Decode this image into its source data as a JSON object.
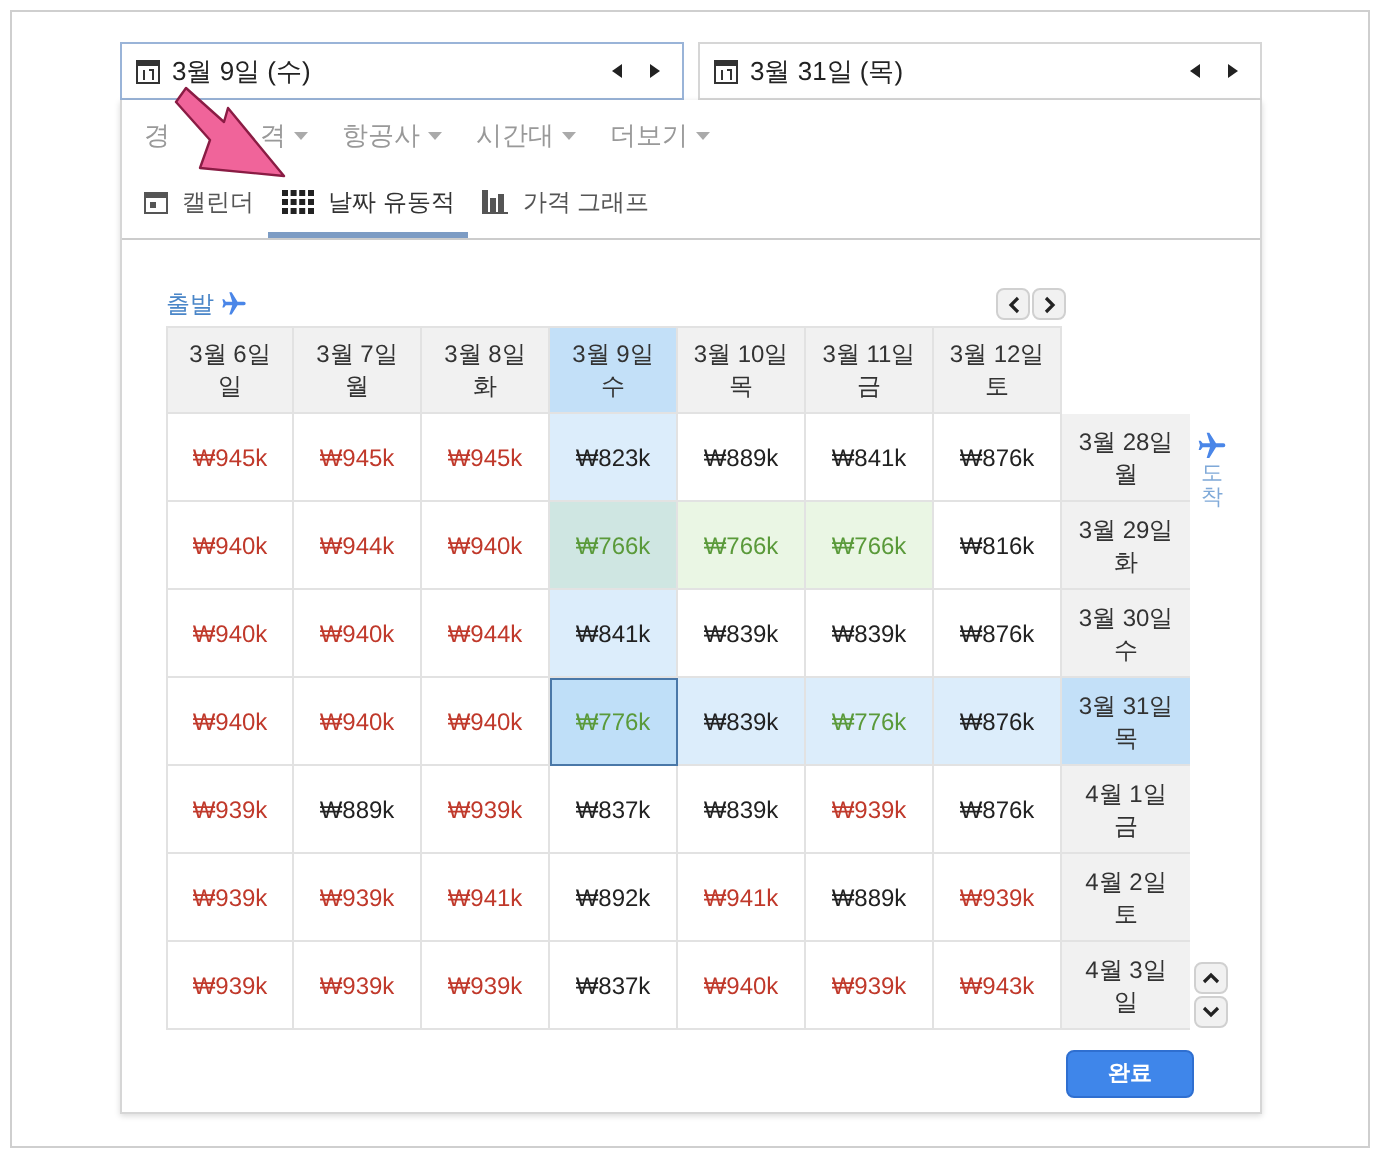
{
  "date_fields": [
    {
      "value": "3월 9일 (수)",
      "selected": true
    },
    {
      "value": "3월 31일 (목)",
      "selected": false
    }
  ],
  "filters": [
    "경",
    "격",
    "항공사",
    "시간대",
    "더보기"
  ],
  "view_tabs": [
    {
      "kind": "calendar",
      "label": "캘린더",
      "selected": false
    },
    {
      "kind": "grid",
      "label": "날짜 유동적",
      "selected": true
    },
    {
      "kind": "chart",
      "label": "가격 그래프",
      "selected": false
    }
  ],
  "departure_label": "출발",
  "arrival_label": "도착",
  "departure_dates": [
    {
      "date": "3월 6일",
      "weekday": "일",
      "selected": false
    },
    {
      "date": "3월 7일",
      "weekday": "월",
      "selected": false
    },
    {
      "date": "3월 8일",
      "weekday": "화",
      "selected": false
    },
    {
      "date": "3월 9일",
      "weekday": "수",
      "selected": true
    },
    {
      "date": "3월 10일",
      "weekday": "목",
      "selected": false
    },
    {
      "date": "3월 11일",
      "weekday": "금",
      "selected": false
    },
    {
      "date": "3월 12일",
      "weekday": "토",
      "selected": false
    }
  ],
  "rows": [
    {
      "date": "3월 28일",
      "weekday": "월",
      "selected": false,
      "cells": [
        {
          "price": "₩945k",
          "color": "#c0392b",
          "lowest": false
        },
        {
          "price": "₩945k",
          "color": "#c0392b",
          "lowest": false
        },
        {
          "price": "₩945k",
          "color": "#c0392b",
          "lowest": false
        },
        {
          "price": "₩823k",
          "color": "#222222",
          "lowest": false
        },
        {
          "price": "₩889k",
          "color": "#222222",
          "lowest": false
        },
        {
          "price": "₩841k",
          "color": "#222222",
          "lowest": false
        },
        {
          "price": "₩876k",
          "color": "#222222",
          "lowest": false
        }
      ]
    },
    {
      "date": "3월 29일",
      "weekday": "화",
      "selected": false,
      "cells": [
        {
          "price": "₩940k",
          "color": "#c0392b",
          "lowest": false
        },
        {
          "price": "₩944k",
          "color": "#c0392b",
          "lowest": false
        },
        {
          "price": "₩940k",
          "color": "#c0392b",
          "lowest": false
        },
        {
          "price": "₩766k",
          "color": "#5a9a3a",
          "lowest": true
        },
        {
          "price": "₩766k",
          "color": "#5a9a3a",
          "lowest": true
        },
        {
          "price": "₩766k",
          "color": "#5a9a3a",
          "lowest": true
        },
        {
          "price": "₩816k",
          "color": "#222222",
          "lowest": false
        }
      ]
    },
    {
      "date": "3월 30일",
      "weekday": "수",
      "selected": false,
      "cells": [
        {
          "price": "₩940k",
          "color": "#c0392b",
          "lowest": false
        },
        {
          "price": "₩940k",
          "color": "#c0392b",
          "lowest": false
        },
        {
          "price": "₩944k",
          "color": "#c0392b",
          "lowest": false
        },
        {
          "price": "₩841k",
          "color": "#222222",
          "lowest": false
        },
        {
          "price": "₩839k",
          "color": "#222222",
          "lowest": false
        },
        {
          "price": "₩839k",
          "color": "#222222",
          "lowest": false
        },
        {
          "price": "₩876k",
          "color": "#222222",
          "lowest": false
        }
      ]
    },
    {
      "date": "3월 31일",
      "weekday": "목",
      "selected": true,
      "cells": [
        {
          "price": "₩940k",
          "color": "#c0392b",
          "lowest": false
        },
        {
          "price": "₩940k",
          "color": "#c0392b",
          "lowest": false
        },
        {
          "price": "₩940k",
          "color": "#c0392b",
          "lowest": false
        },
        {
          "price": "₩776k",
          "color": "#5a9a3a",
          "lowest": false
        },
        {
          "price": "₩839k",
          "color": "#222222",
          "lowest": false
        },
        {
          "price": "₩776k",
          "color": "#5a9a3a",
          "lowest": false
        },
        {
          "price": "₩876k",
          "color": "#222222",
          "lowest": false
        }
      ]
    },
    {
      "date": "4월 1일",
      "weekday": "금",
      "selected": false,
      "cells": [
        {
          "price": "₩939k",
          "color": "#c0392b",
          "lowest": false
        },
        {
          "price": "₩889k",
          "color": "#222222",
          "lowest": false
        },
        {
          "price": "₩939k",
          "color": "#c0392b",
          "lowest": false
        },
        {
          "price": "₩837k",
          "color": "#222222",
          "lowest": false
        },
        {
          "price": "₩839k",
          "color": "#222222",
          "lowest": false
        },
        {
          "price": "₩939k",
          "color": "#c0392b",
          "lowest": false
        },
        {
          "price": "₩876k",
          "color": "#222222",
          "lowest": false
        }
      ]
    },
    {
      "date": "4월 2일",
      "weekday": "토",
      "selected": false,
      "cells": [
        {
          "price": "₩939k",
          "color": "#c0392b",
          "lowest": false
        },
        {
          "price": "₩939k",
          "color": "#c0392b",
          "lowest": false
        },
        {
          "price": "₩941k",
          "color": "#c0392b",
          "lowest": false
        },
        {
          "price": "₩892k",
          "color": "#222222",
          "lowest": false
        },
        {
          "price": "₩941k",
          "color": "#c0392b",
          "lowest": false
        },
        {
          "price": "₩889k",
          "color": "#222222",
          "lowest": false
        },
        {
          "price": "₩939k",
          "color": "#c0392b",
          "lowest": false
        }
      ]
    },
    {
      "date": "4월 3일",
      "weekday": "일",
      "selected": false,
      "cells": [
        {
          "price": "₩939k",
          "color": "#c0392b",
          "lowest": false
        },
        {
          "price": "₩939k",
          "color": "#c0392b",
          "lowest": false
        },
        {
          "price": "₩939k",
          "color": "#c0392b",
          "lowest": false
        },
        {
          "price": "₩837k",
          "color": "#222222",
          "lowest": false
        },
        {
          "price": "₩940k",
          "color": "#c0392b",
          "lowest": false
        },
        {
          "price": "₩939k",
          "color": "#c0392b",
          "lowest": false
        },
        {
          "price": "₩943k",
          "color": "#c0392b",
          "lowest": false
        }
      ]
    }
  ],
  "done_button": "완료"
}
